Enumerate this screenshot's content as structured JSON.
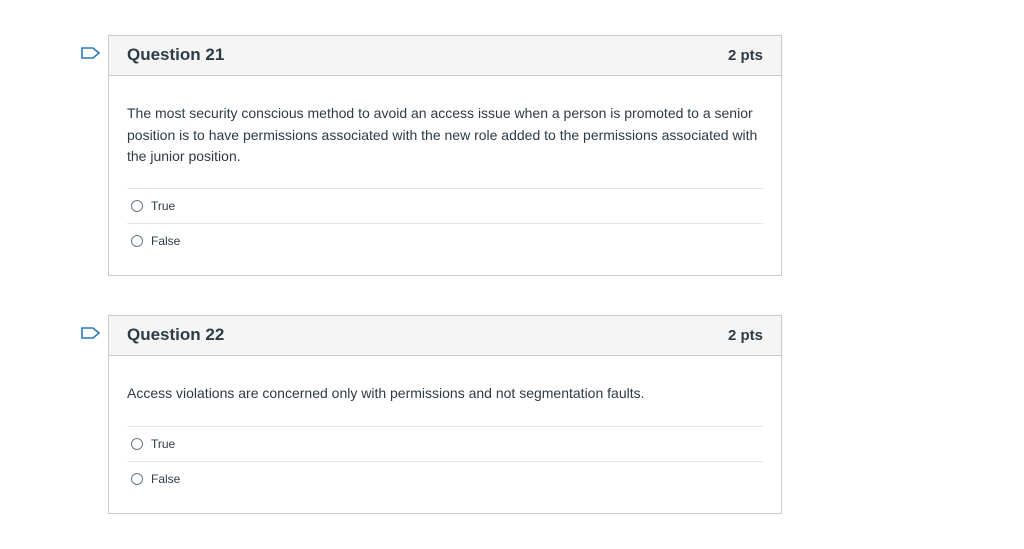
{
  "questions": [
    {
      "title": "Question 21",
      "points": "2 pts",
      "text": "The most security conscious method to avoid an access issue when a person is promoted to a senior position is to have permissions associated with the new role added to the permissions associated with the junior position.",
      "flag_icon": "flag-outline-icon",
      "answers": [
        {
          "label": "True",
          "selected": false
        },
        {
          "label": "False",
          "selected": false
        }
      ]
    },
    {
      "title": "Question 22",
      "points": "2 pts",
      "text": "Access violations are concerned only with permissions and not segmentation faults.",
      "flag_icon": "flag-outline-icon",
      "answers": [
        {
          "label": "True",
          "selected": false
        },
        {
          "label": "False",
          "selected": false
        }
      ]
    }
  ],
  "colors": {
    "flag": "#2b7abc",
    "border": "#c7cdd1",
    "header_bg": "#f5f5f5",
    "text": "#2d3b45"
  }
}
